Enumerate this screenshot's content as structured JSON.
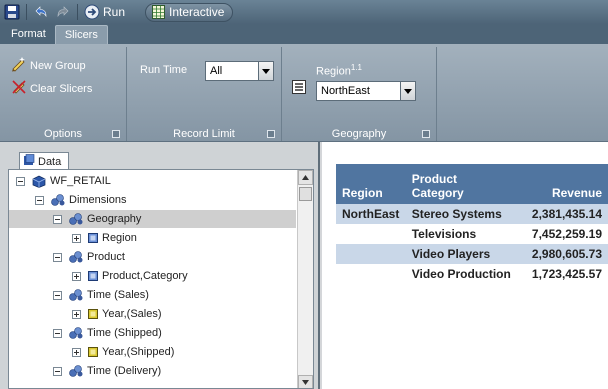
{
  "toolbar": {
    "run_label": "Run",
    "interactive_label": "Interactive"
  },
  "tabs": [
    {
      "label": "Format"
    },
    {
      "label": "Slicers"
    }
  ],
  "ribbon": {
    "options": {
      "new_group": "New Group",
      "clear_slicers": "Clear Slicers",
      "label": "Options"
    },
    "record_limit": {
      "run_time_label": "Run Time",
      "run_time_value": "All",
      "label": "Record Limit"
    },
    "geography": {
      "region_label": "Region",
      "region_superscript": "1.1",
      "region_value": "NorthEast",
      "label": "Geography"
    }
  },
  "data_panel": {
    "tab_label": "Data",
    "tree": [
      {
        "label": "WF_RETAIL",
        "level": 0,
        "toggle": "minus",
        "icon": "cube-icon"
      },
      {
        "label": "Dimensions",
        "level": 1,
        "toggle": "minus",
        "icon": "dimensions-icon"
      },
      {
        "label": "Geography",
        "level": 2,
        "toggle": "minus",
        "icon": "hierarchy-icon",
        "selected": true
      },
      {
        "label": "Region",
        "level": 3,
        "toggle": "plus",
        "icon": "field-icon"
      },
      {
        "label": "Product",
        "level": 2,
        "toggle": "minus",
        "icon": "hierarchy-icon"
      },
      {
        "label": "Product,Category",
        "level": 3,
        "toggle": "plus",
        "icon": "field-icon"
      },
      {
        "label": "Time (Sales)",
        "level": 2,
        "toggle": "minus",
        "icon": "hierarchy-icon"
      },
      {
        "label": "Year,(Sales)",
        "level": 3,
        "toggle": "plus",
        "icon": "date-field-icon"
      },
      {
        "label": "Time (Shipped)",
        "level": 2,
        "toggle": "minus",
        "icon": "hierarchy-icon"
      },
      {
        "label": "Year,(Shipped)",
        "level": 3,
        "toggle": "plus",
        "icon": "date-field-icon"
      },
      {
        "label": "Time (Delivery)",
        "level": 2,
        "toggle": "minus",
        "icon": "hierarchy-icon"
      }
    ]
  },
  "report": {
    "columns": [
      "Region",
      "Product Category",
      "Revenue"
    ],
    "rows": [
      {
        "region": "NorthEast",
        "category": "Stereo Systems",
        "revenue": "2,381,435.14"
      },
      {
        "region": "",
        "category": "Televisions",
        "revenue": "7,452,259.19"
      },
      {
        "region": "",
        "category": "Video Players",
        "revenue": "2,980,605.73"
      },
      {
        "region": "",
        "category": "Video Production",
        "revenue": "1,723,425.57"
      }
    ]
  },
  "colors": {
    "header_blue": "#5075a0",
    "row_band": "#c9d7e8",
    "ribbon": "#8e9fad"
  }
}
